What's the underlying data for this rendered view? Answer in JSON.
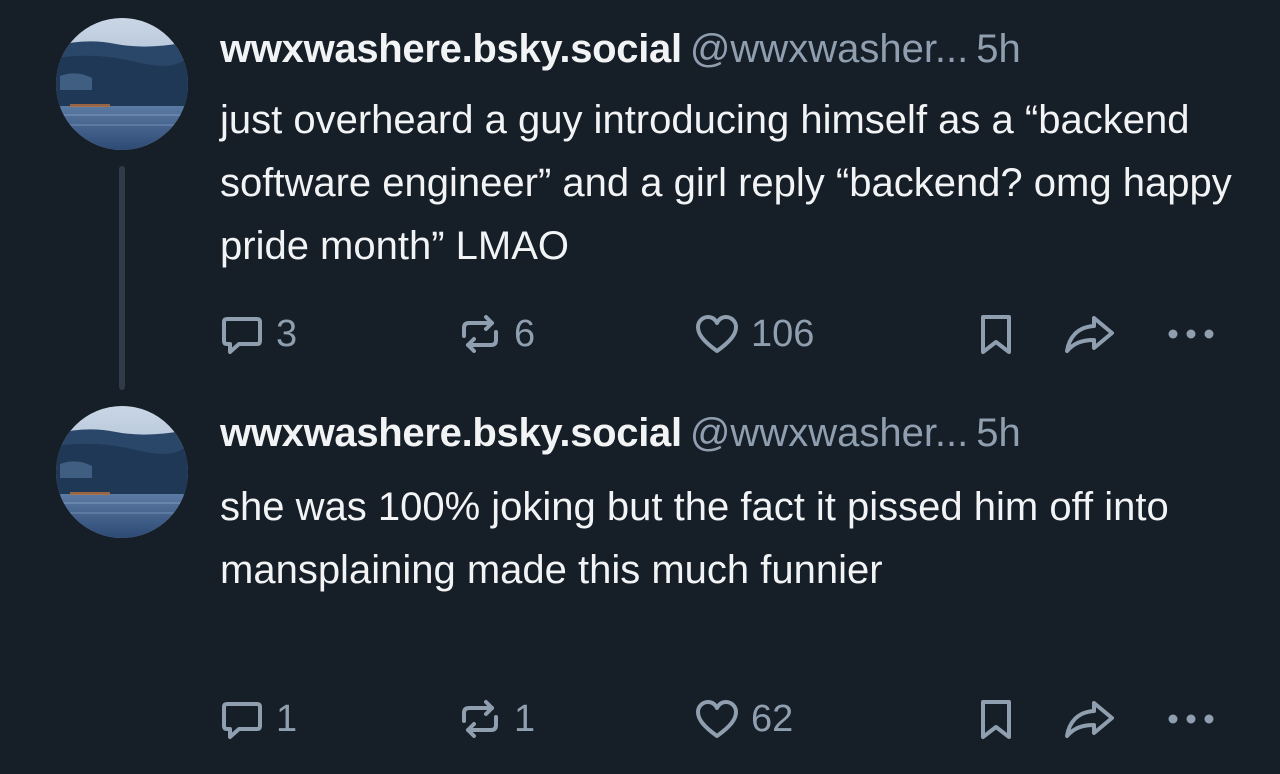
{
  "posts": [
    {
      "display_name": "wwxwashere.bsky.social",
      "handle": "@wwxwasher...",
      "time": "5h",
      "text": "just overheard a guy introducing himself as a “backend software engineer” and a girl reply “backend? omg happy pride month” LMAO",
      "replies": "3",
      "reposts": "6",
      "likes": "106",
      "avatar_icon": "ocean-landscape-avatar"
    },
    {
      "display_name": "wwxwashere.bsky.social",
      "handle": "@wwxwasher...",
      "time": "5h",
      "text": "she was 100% joking but the fact it pissed him off into mansplaining made this much funnier",
      "replies": "1",
      "reposts": "1",
      "likes": "62",
      "avatar_icon": "ocean-landscape-avatar"
    }
  ],
  "icons": {
    "reply": "speech-bubble-icon",
    "repost": "repost-arrows-icon",
    "like": "heart-icon",
    "bookmark": "bookmark-icon",
    "share": "share-arrow-icon",
    "more": "ellipsis-icon"
  },
  "colors": {
    "background": "#161e27",
    "text": "#f1f3f5",
    "muted": "#8f9fb0",
    "thread_line": "#2f3b48"
  }
}
